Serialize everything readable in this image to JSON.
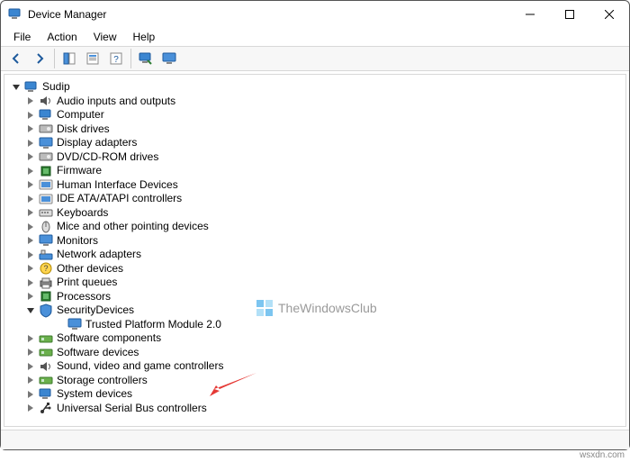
{
  "window": {
    "title": "Device Manager"
  },
  "menu": {
    "file": "File",
    "action": "Action",
    "view": "View",
    "help": "Help"
  },
  "root": {
    "label": "Sudip"
  },
  "categories": [
    {
      "label": "Audio inputs and outputs",
      "icon": "audio"
    },
    {
      "label": "Computer",
      "icon": "computer"
    },
    {
      "label": "Disk drives",
      "icon": "disk"
    },
    {
      "label": "Display adapters",
      "icon": "display"
    },
    {
      "label": "DVD/CD-ROM drives",
      "icon": "dvd"
    },
    {
      "label": "Firmware",
      "icon": "firmware"
    },
    {
      "label": "Human Interface Devices",
      "icon": "hid"
    },
    {
      "label": "IDE ATA/ATAPI controllers",
      "icon": "ide"
    },
    {
      "label": "Keyboards",
      "icon": "keyboard"
    },
    {
      "label": "Mice and other pointing devices",
      "icon": "mouse"
    },
    {
      "label": "Monitors",
      "icon": "monitor"
    },
    {
      "label": "Network adapters",
      "icon": "network"
    },
    {
      "label": "Other devices",
      "icon": "other"
    },
    {
      "label": "Print queues",
      "icon": "print"
    },
    {
      "label": "Processors",
      "icon": "cpu"
    },
    {
      "label": "SecurityDevices",
      "icon": "security",
      "expanded": true,
      "children": [
        {
          "label": "Trusted Platform Module 2.0",
          "icon": "tpm"
        }
      ]
    },
    {
      "label": "Software components",
      "icon": "swcomp"
    },
    {
      "label": "Software devices",
      "icon": "swdev"
    },
    {
      "label": "Sound, video and game controllers",
      "icon": "sound"
    },
    {
      "label": "Storage controllers",
      "icon": "storage"
    },
    {
      "label": "System devices",
      "icon": "system"
    },
    {
      "label": "Universal Serial Bus controllers",
      "icon": "usb"
    }
  ],
  "watermark": "TheWindowsClub",
  "source": "wsxdn.com"
}
